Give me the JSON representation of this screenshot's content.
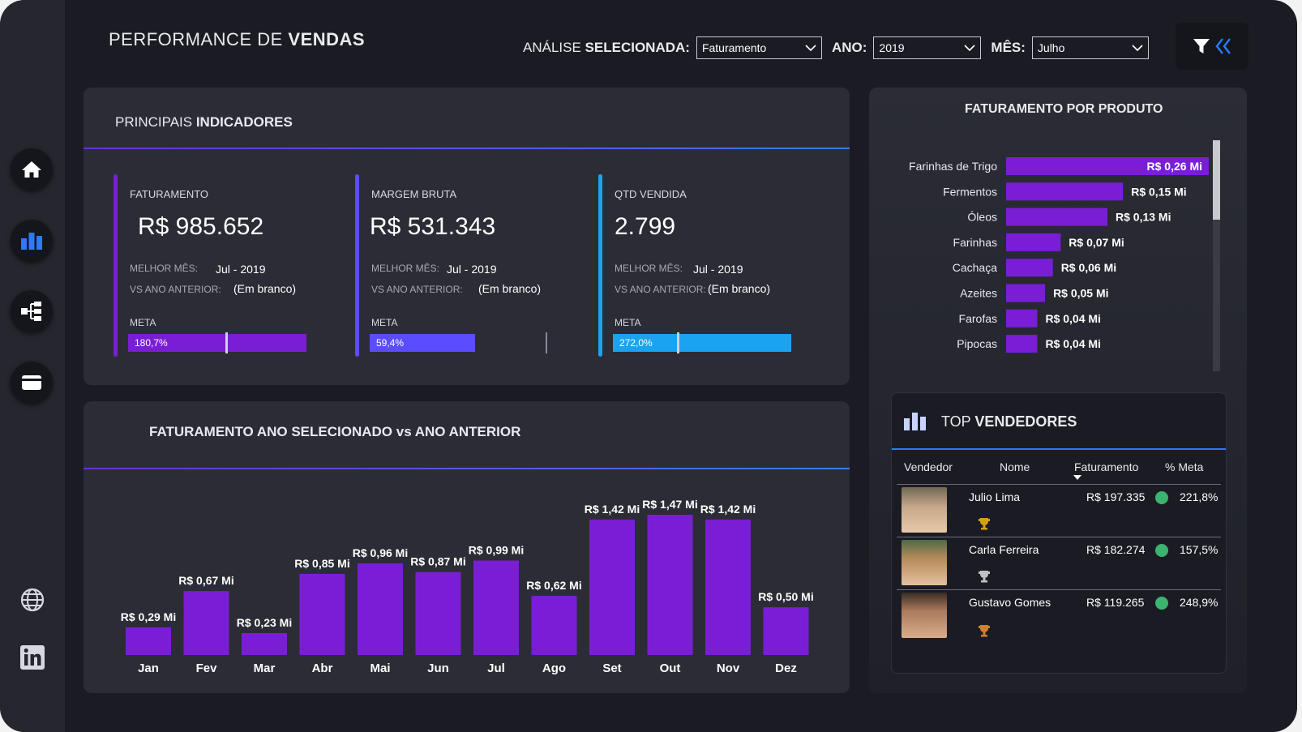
{
  "header": {
    "title_light": "PERFORMANCE DE ",
    "title_bold": "VENDAS",
    "filters": {
      "analysis_label_light": "ANÁLISE ",
      "analysis_label_bold": "SELECIONADA:",
      "analysis_value": "Faturamento",
      "year_label": "ANO:",
      "year_value": "2019",
      "month_label": "MÊS:",
      "month_value": "Julho"
    }
  },
  "sidebar": {
    "items": [
      {
        "name": "home-icon"
      },
      {
        "name": "bar-chart-icon"
      },
      {
        "name": "hierarchy-icon"
      },
      {
        "name": "card-icon"
      },
      {
        "name": "globe-icon"
      },
      {
        "name": "linkedin-icon"
      }
    ]
  },
  "kpis": {
    "title_light": "PRINCIPAIS ",
    "title_bold": "INDICADORES",
    "best_month_label": "MELHOR MÊS:",
    "vs_label": "VS ANO ANTERIOR:",
    "meta_label": "META",
    "items": [
      {
        "label": "FATURAMENTO",
        "value": "R$ 985.652",
        "best_month": "Jul - 2019",
        "vs_prev": "(Em branco)",
        "meta_text": "180,7%",
        "meta_progress": 1.807,
        "color": "#7a1ed6"
      },
      {
        "label": "MARGEM BRUTA",
        "value": "R$ 531.343",
        "best_month": "Jul - 2019",
        "vs_prev": "(Em branco)",
        "meta_text": "59,4%",
        "meta_progress": 0.594,
        "color": "#5b4dff"
      },
      {
        "label": "QTD VENDIDA",
        "value": "2.799",
        "best_month": "Jul - 2019",
        "vs_prev": "(Em branco)",
        "meta_text": "272,0%",
        "meta_progress": 2.72,
        "color": "#1aa3f0"
      }
    ]
  },
  "monthly": {
    "title": "FATURAMENTO ANO SELECIONADO vs ANO ANTERIOR"
  },
  "chart_data": {
    "type": "bar",
    "title": "FATURAMENTO ANO SELECIONADO vs ANO ANTERIOR",
    "categories": [
      "Jan",
      "Fev",
      "Mar",
      "Abr",
      "Mai",
      "Jun",
      "Jul",
      "Ago",
      "Set",
      "Out",
      "Nov",
      "Dez"
    ],
    "values": [
      0.29,
      0.67,
      0.23,
      0.85,
      0.96,
      0.87,
      0.99,
      0.62,
      1.42,
      1.47,
      1.42,
      0.5
    ],
    "labels": [
      "R$ 0,29 Mi",
      "R$ 0,67 Mi",
      "R$ 0,23 Mi",
      "R$ 0,85 Mi",
      "R$ 0,96 Mi",
      "R$ 0,87 Mi",
      "R$ 0,99 Mi",
      "R$ 0,62 Mi",
      "R$ 1,42 Mi",
      "R$ 1,47 Mi",
      "R$ 1,42 Mi",
      "R$ 0,50 Mi"
    ],
    "color": "#7a1ed6",
    "xlabel": "",
    "ylabel": "",
    "ylim": [
      0,
      1.5
    ]
  },
  "product_chart": {
    "title": "FATURAMENTO POR PRODUTO",
    "type": "bar",
    "orientation": "horizontal",
    "categories": [
      "Farinhas de Trigo",
      "Fermentos",
      "Óleos",
      "Farinhas",
      "Cachaça",
      "Azeites",
      "Farofas",
      "Pipocas"
    ],
    "values": [
      0.26,
      0.15,
      0.13,
      0.07,
      0.06,
      0.05,
      0.04,
      0.04
    ],
    "labels": [
      "R$ 0,26 Mi",
      "R$ 0,15 Mi",
      "R$ 0,13 Mi",
      "R$ 0,07 Mi",
      "R$ 0,06 Mi",
      "R$ 0,05 Mi",
      "R$ 0,04 Mi",
      "R$ 0,04 Mi"
    ],
    "color": "#7a1ed6"
  },
  "sellers": {
    "title_light": "TOP ",
    "title_bold": "VENDEDORES",
    "columns": [
      "Vendedor",
      "Nome",
      "Faturamento",
      "% Meta"
    ],
    "rows": [
      {
        "name": "Julio Lima",
        "revenue": "R$ 197.335",
        "meta": "221,8%",
        "trophy_color": "#d4a017"
      },
      {
        "name": "Carla Ferreira",
        "revenue": "R$ 182.274",
        "meta": "157,5%",
        "trophy_color": "#c0c0c0"
      },
      {
        "name": "Gustavo Gomes",
        "revenue": "R$ 119.265",
        "meta": "248,9%",
        "trophy_color": "#cd7f32"
      }
    ]
  }
}
